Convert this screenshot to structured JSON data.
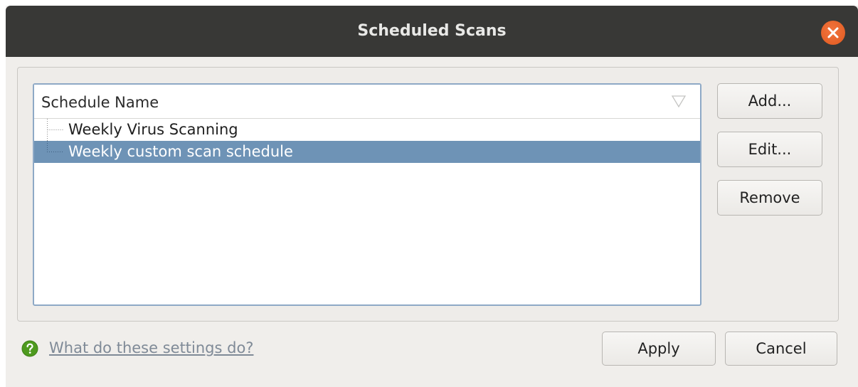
{
  "window": {
    "title": "Scheduled Scans"
  },
  "schedule_list": {
    "column_header": "Schedule Name",
    "items": [
      {
        "label": "Weekly Virus Scanning",
        "selected": false
      },
      {
        "label": "Weekly custom scan schedule",
        "selected": true
      }
    ]
  },
  "side_buttons": {
    "add_label": "Add...",
    "edit_label": "Edit...",
    "remove_label": "Remove"
  },
  "footer": {
    "help_link": "What do these settings do?",
    "apply_label": "Apply",
    "cancel_label": "Cancel"
  },
  "colors": {
    "titlebar": "#383836",
    "close_button": "#e9642a",
    "selection": "#6e93b6",
    "help_icon": "#4e9a1e",
    "link": "#7f8a97"
  }
}
